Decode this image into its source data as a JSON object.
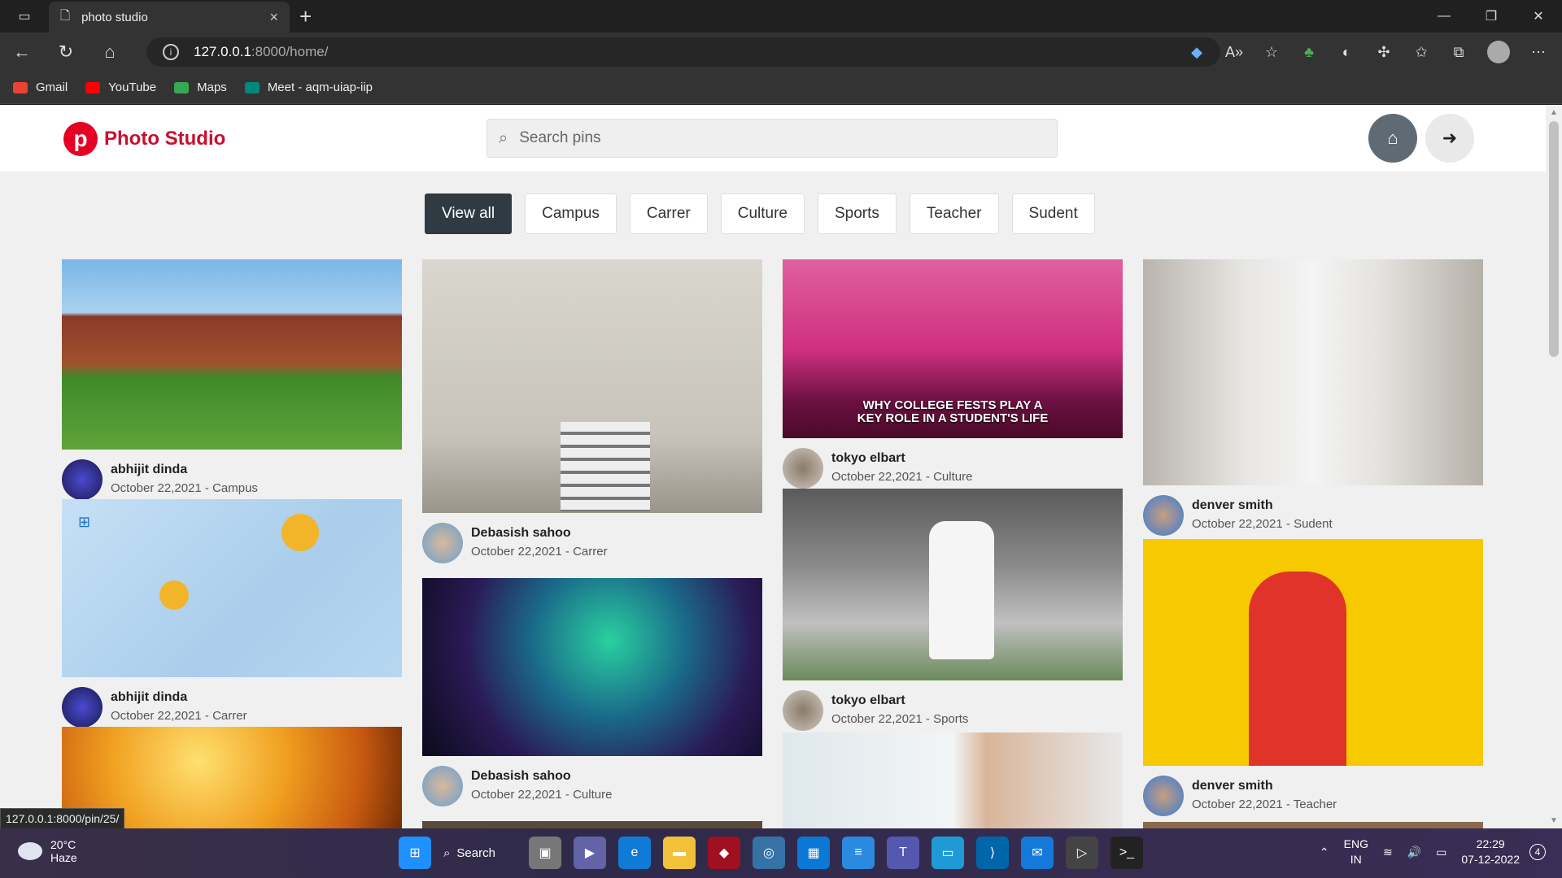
{
  "browser": {
    "tab_title": "photo studio",
    "url_host": "127.0.0.1",
    "url_path": ":8000/home/",
    "bookmarks": [
      "Gmail",
      "YouTube",
      "Maps",
      "Meet - aqm-uiap-iip"
    ]
  },
  "header": {
    "brand": "Photo Studio",
    "logo_letter": "p",
    "search_placeholder": "Search pins"
  },
  "filters": [
    "View all",
    "Campus",
    "Carrer",
    "Culture",
    "Sports",
    "Teacher",
    "Sudent"
  ],
  "pins": [
    {
      "name": "abhijit dinda",
      "meta": "October 22,2021 -  Campus"
    },
    {
      "name": "abhijit dinda",
      "meta": "October 22,2021 -  Carrer"
    },
    {
      "name": "Debasish sahoo",
      "meta": "October 22,2021 -  Carrer"
    },
    {
      "name": "Debasish sahoo",
      "meta": "October 22,2021 -  Culture"
    },
    {
      "name": "tokyo elbart",
      "meta": "October 22,2021 -  Culture",
      "caption": "WHY COLLEGE FESTS PLAY A KEY ROLE IN A STUDENT'S LIFE"
    },
    {
      "name": "tokyo elbart",
      "meta": "October 22,2021 -  Sports"
    },
    {
      "name": "denver smith",
      "meta": "October 22,2021 -  Sudent"
    },
    {
      "name": "denver smith",
      "meta": "October 22,2021 -  Teacher"
    }
  ],
  "status_url": "127.0.0.1:8000/pin/25/",
  "taskbar": {
    "temp": "20°C",
    "weather": "Haze",
    "search_label": "Search",
    "lang1": "ENG",
    "lang2": "IN",
    "time": "22:29",
    "date": "07-12-2022",
    "notifications": "4"
  },
  "colors": {
    "brand": "#c8102e",
    "active_filter": "#2f3a42"
  }
}
